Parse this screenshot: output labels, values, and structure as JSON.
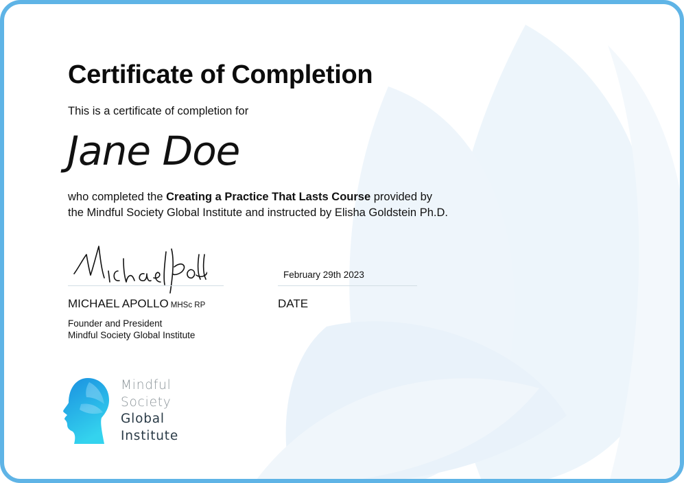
{
  "certificate": {
    "title": "Certificate of Completion",
    "intro": "This is a certificate of completion for",
    "recipient": "Jane Doe",
    "description": {
      "prefix": "who completed the",
      "course": "Creating a Practice That Lasts Course",
      "mid": "provided by",
      "line2": "the Mindful Society Global Institute and instructed by Elisha Goldstein Ph.D."
    }
  },
  "signer": {
    "name": "MICHAEL APOLLO",
    "credentials": "MHSc RP",
    "role": "Founder and President",
    "organization": "Mindful Society Global Institute"
  },
  "date": {
    "value": "February 29th 2023",
    "label": "DATE"
  },
  "logo": {
    "line1": "Mindful",
    "line2": "Society",
    "line3": "Global",
    "line4": "Institute",
    "icon": "head-silhouette-icon"
  },
  "colors": {
    "border": "#5fb4e6",
    "logo_gradient_top": "#1a8fe0",
    "logo_gradient_bottom": "#34d3ee",
    "watermark": "#eaf3fa"
  }
}
